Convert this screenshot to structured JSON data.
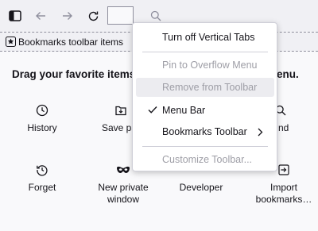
{
  "bookmarks_toolbar": {
    "item_label": "Bookmarks toolbar items"
  },
  "palette": {
    "title": "Drag your favorite items",
    "title_tail": "enu.",
    "items": [
      {
        "label": "History",
        "icon": "clock-icon"
      },
      {
        "label": "Save pa",
        "icon": "save-page-icon"
      },
      {
        "label": "nd",
        "icon": "search-icon"
      },
      {
        "label": "Forget",
        "icon": "forget-icon"
      },
      {
        "label": "New private window",
        "icon": "private-mask-icon"
      },
      {
        "label": "Developer",
        "icon": ""
      },
      {
        "label": "Import bookmarks…",
        "icon": "import-icon"
      }
    ]
  },
  "context_menu": {
    "items": [
      {
        "label": "Turn off Vertical Tabs",
        "enabled": true
      },
      {
        "label": "Pin to Overflow Menu",
        "enabled": false
      },
      {
        "label": "Remove from Toolbar",
        "enabled": false,
        "highlighted": true
      },
      {
        "label": "Menu Bar",
        "enabled": true,
        "checked": true
      },
      {
        "label": "Bookmarks Toolbar",
        "enabled": true,
        "submenu": true
      },
      {
        "label": "Customize Toolbar...",
        "enabled": false
      }
    ]
  }
}
